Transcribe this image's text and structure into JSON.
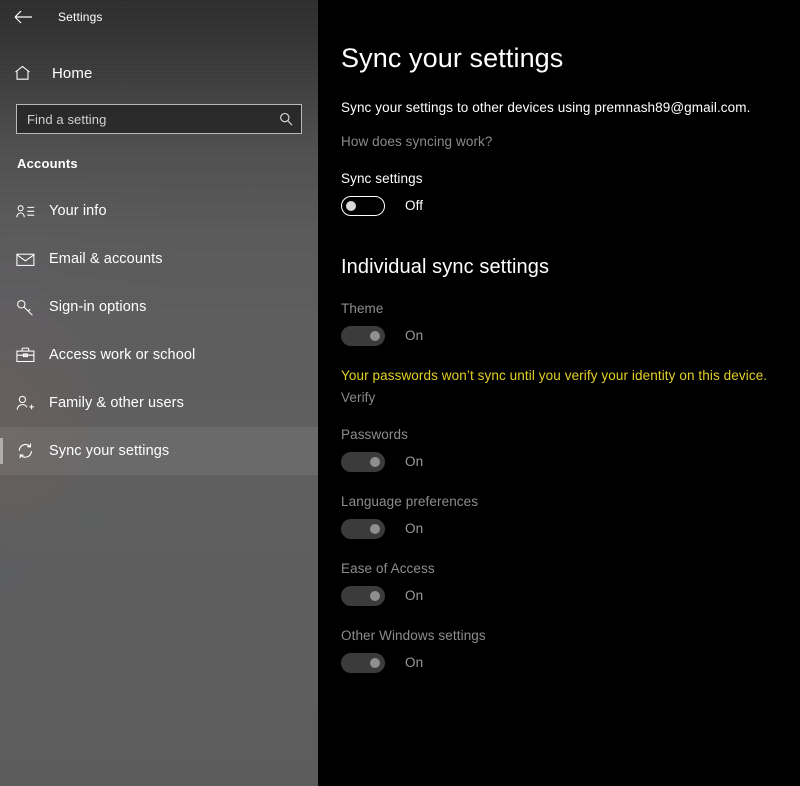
{
  "window": {
    "title": "Settings",
    "back_icon": "back-arrow-icon"
  },
  "sidebar": {
    "home": {
      "label": "Home",
      "icon": "home-icon"
    },
    "search": {
      "placeholder": "Find a setting",
      "value": "",
      "icon": "search-icon"
    },
    "group_heading": "Accounts",
    "items": [
      {
        "label": "Your info",
        "icon": "user-details-icon",
        "selected": false
      },
      {
        "label": "Email & accounts",
        "icon": "envelope-icon",
        "selected": false
      },
      {
        "label": "Sign-in options",
        "icon": "key-icon",
        "selected": false
      },
      {
        "label": "Access work or school",
        "icon": "briefcase-icon",
        "selected": false
      },
      {
        "label": "Family & other users",
        "icon": "user-add-icon",
        "selected": false
      },
      {
        "label": "Sync your settings",
        "icon": "sync-icon",
        "selected": true
      }
    ]
  },
  "main": {
    "title": "Sync your settings",
    "description": "Sync your settings to other devices using premnash89@gmail.com.",
    "help_link": "How does syncing work?",
    "master_toggle": {
      "label": "Sync settings",
      "state": "Off",
      "enabled": true
    },
    "section_heading": "Individual sync settings",
    "warning": {
      "text": "Your passwords won’t sync until you verify your identity on this device.",
      "link": "Verify",
      "color": "#e3cf23"
    },
    "individual_settings": [
      {
        "label": "Theme",
        "state": "On",
        "enabled": false
      },
      {
        "label": "Passwords",
        "state": "On",
        "enabled": false
      },
      {
        "label": "Language preferences",
        "state": "On",
        "enabled": false
      },
      {
        "label": "Ease of Access",
        "state": "On",
        "enabled": false
      },
      {
        "label": "Other Windows settings",
        "state": "On",
        "enabled": false
      }
    ]
  },
  "colors": {
    "content_background": "#000000",
    "sidebar_base": "#5d5d5d",
    "accent_warning": "#e3cf23",
    "text_primary": "#ffffff",
    "text_disabled": "#8d8d8d"
  }
}
